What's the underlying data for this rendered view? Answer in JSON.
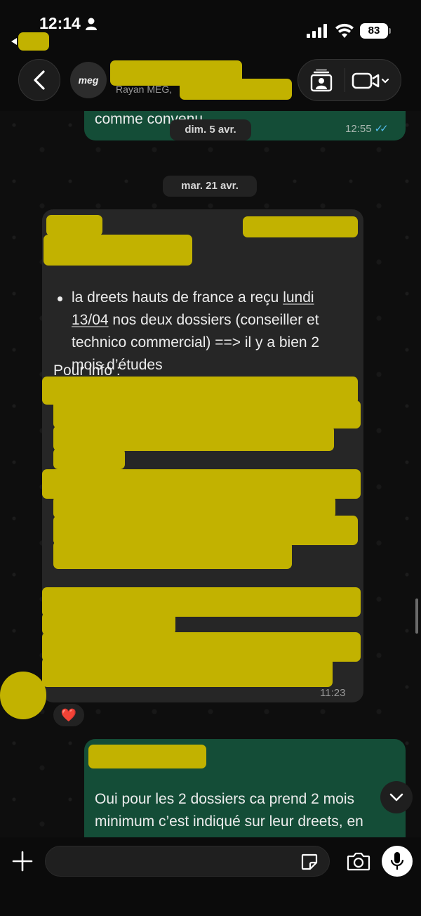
{
  "status_bar": {
    "time": "12:14",
    "battery": "83",
    "back_app_label": ""
  },
  "header": {
    "avatar_text": "meg",
    "subtitle": "Rayan MEG,"
  },
  "messages": {
    "prev_out_text": "comme convenu",
    "prev_out_time": "12:55",
    "date1": "dim. 5 avr.",
    "date2": "mar. 21 avr.",
    "in_intro": "Pour info :",
    "in_bullet_a": "la dreets hauts de france a reçu ",
    "in_bullet_link": "lundi 13/04",
    "in_bullet_b": " nos deux dossiers (conseiller et technico commercial) ==> il y a bien 2 mois d’études",
    "in_time": "11:23",
    "reaction": "❤️",
    "reply_text": "Oui pour les 2 dossiers ca prend 2 mois minimum c’est indiqué sur leur dreets, en"
  },
  "input": {
    "placeholder": ""
  },
  "colors": {
    "outgoing_bubble": "#144d37",
    "incoming_bubble": "#262626",
    "redaction": "#c2b200",
    "read_ticks": "#53bdeb"
  }
}
